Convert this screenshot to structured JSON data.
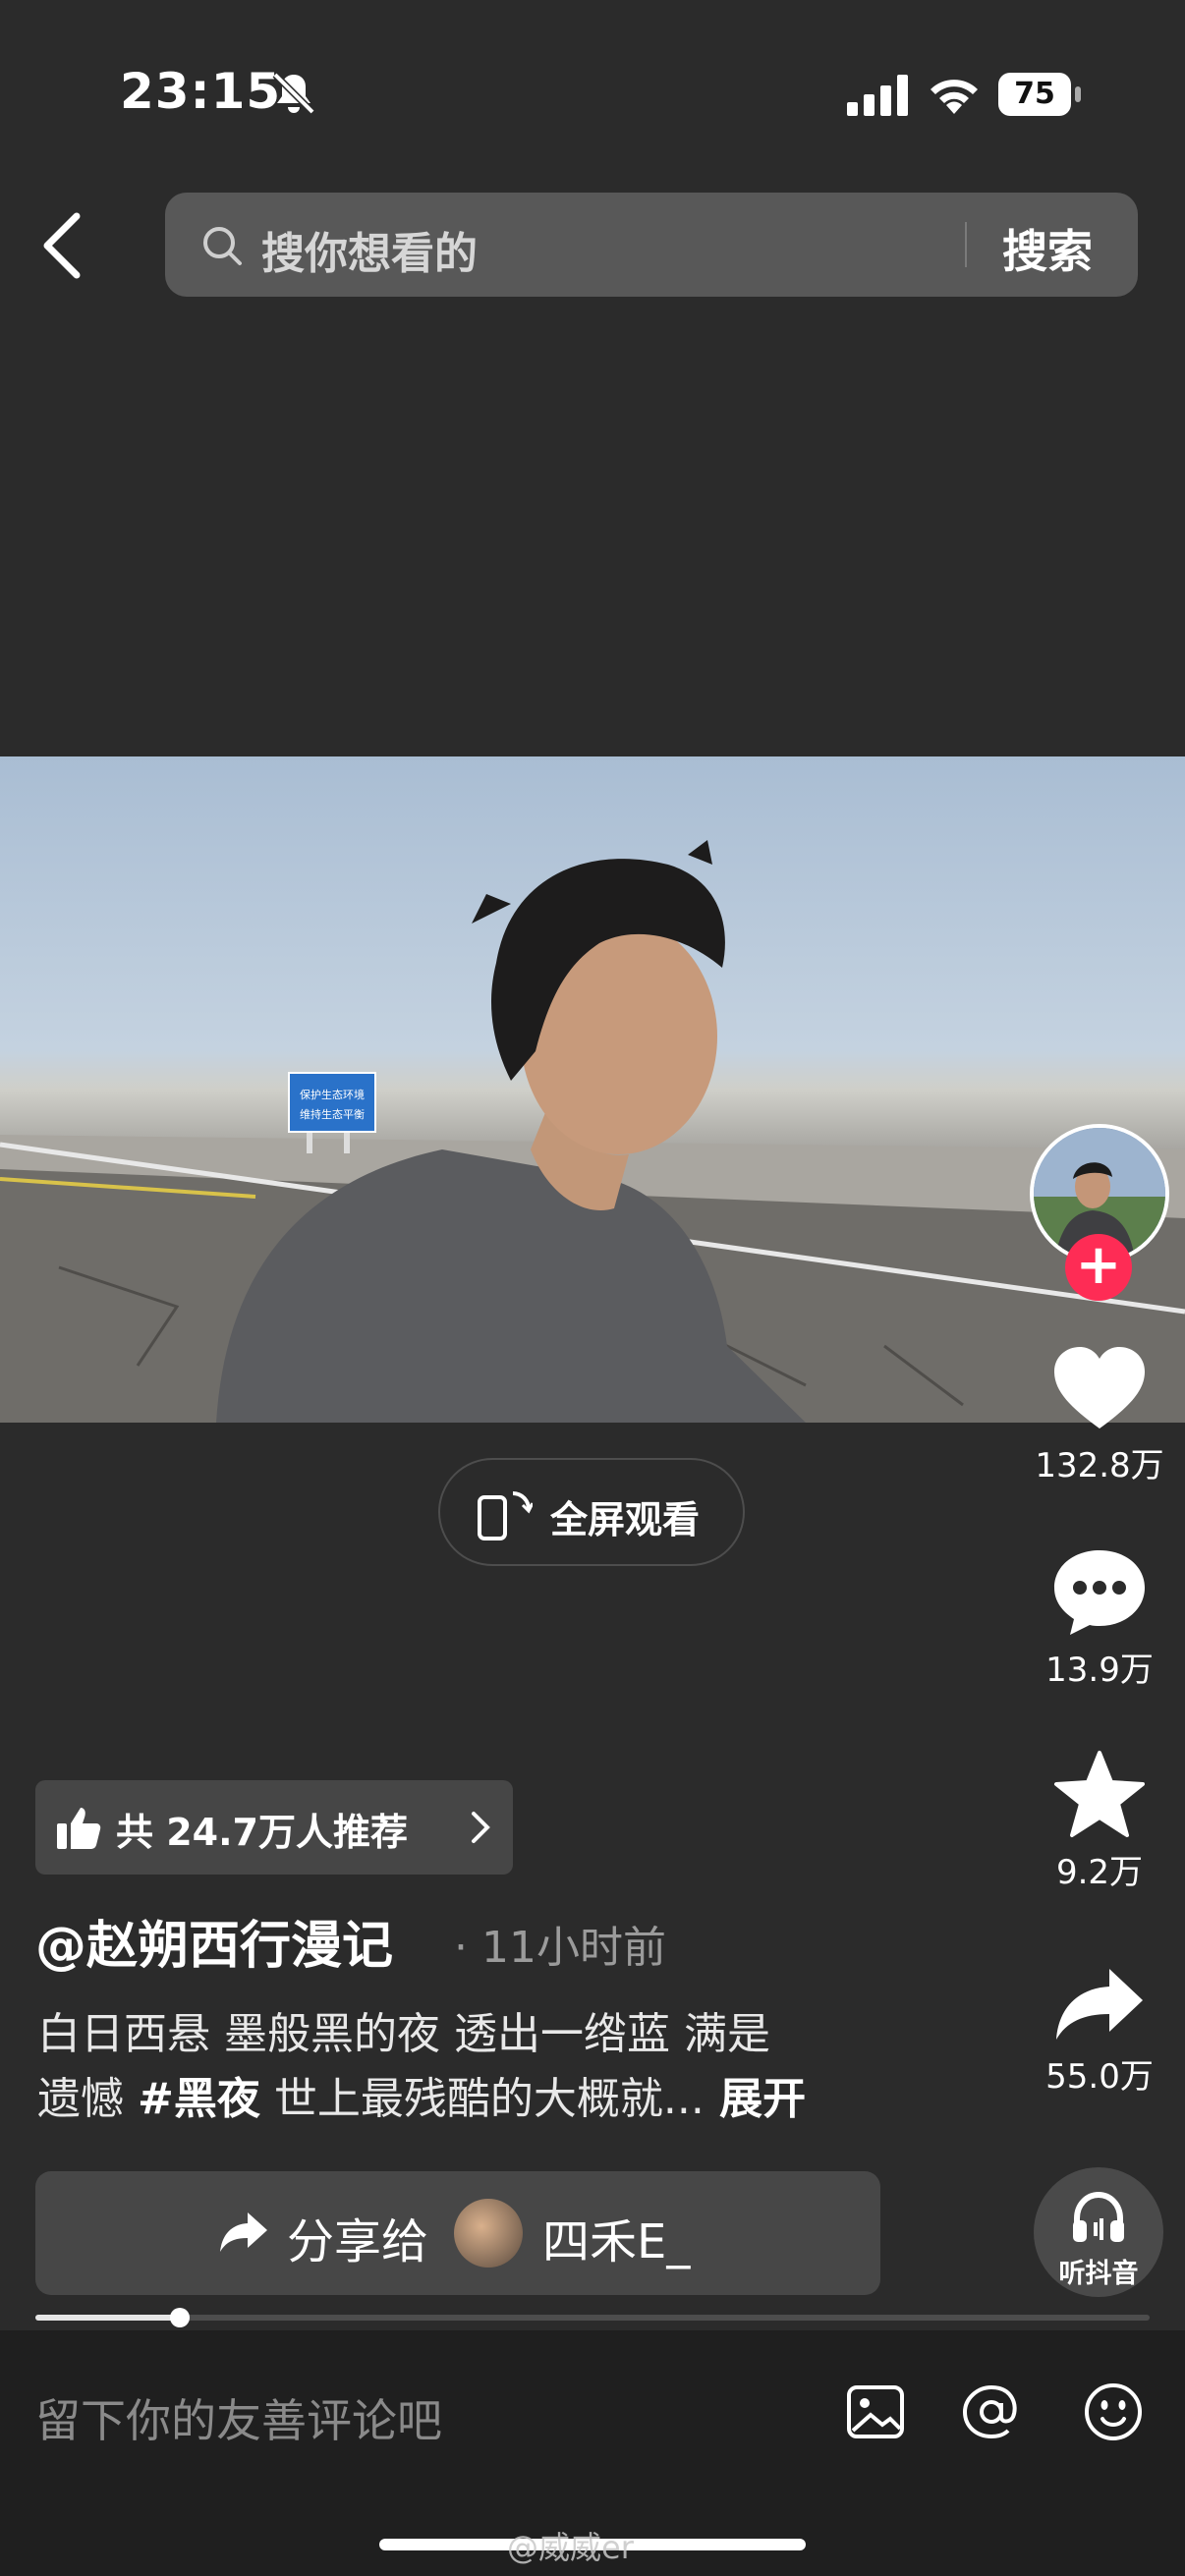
{
  "status_bar": {
    "time": "23:15",
    "battery": "75"
  },
  "search": {
    "placeholder": "搜你想看的",
    "button": "搜索"
  },
  "video": {
    "sign_lines": [
      "保护生态环境",
      "维持生态平衡"
    ],
    "fullscreen_label": "全屏观看",
    "progress_fraction": 0.13
  },
  "actions": {
    "likes": "132.8万",
    "comments": "13.9万",
    "favorites": "9.2万",
    "shares": "55.0万",
    "follow": "+",
    "listen_label": "听抖音"
  },
  "post": {
    "recommend": "共 24.7万人推荐",
    "author": "@赵朔西行漫记",
    "separator": "·",
    "time_ago": "11小时前",
    "desc_line1": "白日西悬 墨般黑的夜 透出一绺蓝 满是",
    "desc_line2_a": "遗憾 ",
    "hashtag": "#黑夜",
    "desc_line2_b": " 世上最残酷的大概就...",
    "expand": " 展开",
    "share_label": "分享给",
    "share_to": "四禾E_"
  },
  "comment_bar": {
    "placeholder": "留下你的友善评论吧"
  },
  "watermark": "@威威er",
  "colors": {
    "accent": "#fe2c55",
    "background": "#2b2b2b",
    "bar": "#1f1f1f"
  },
  "icons": [
    "bell-off-icon",
    "signal-icon",
    "wifi-icon",
    "battery-icon",
    "back-icon",
    "search-icon",
    "fullscreen-icon",
    "heart-icon",
    "comment-icon",
    "star-icon",
    "share-icon",
    "headphones-icon",
    "thumbs-up-icon",
    "chevron-right-icon",
    "image-icon",
    "at-icon",
    "emoji-icon"
  ]
}
